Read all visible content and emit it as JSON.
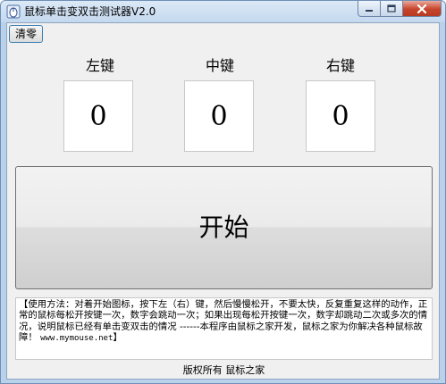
{
  "window": {
    "title": "鼠标单击变双击测试器V2.0"
  },
  "toolbar": {
    "reset_label": "清零"
  },
  "keys": [
    {
      "label": "左键",
      "count": "0"
    },
    {
      "label": "中键",
      "count": "0"
    },
    {
      "label": "右键",
      "count": "0"
    }
  ],
  "start": {
    "label": "开始"
  },
  "instructions": {
    "text": "【使用方法：对着开始图标，按下左（右）键，然后慢慢松开，不要太快，反复重复这样的动作，正常的鼠标每松开按键一次，数字会跳动一次；如果出现每松开按键一次，数字却跳动二次或多次的情况，说明鼠标已经有单击变双击的情况 ------本程序由鼠标之家开发，鼠标之家为你解决各种鼠标故障！ ",
    "url": "www.mymouse.net",
    "suffix": "】"
  },
  "footer": {
    "text": "版权所有 鼠标之家"
  },
  "colors": {
    "frame": "#b9d1ea",
    "client": "#f0f0f0",
    "close_button": "#c7442c"
  },
  "icons": {
    "app": "mouse-app-icon",
    "minimize": "minimize-icon",
    "maximize": "maximize-icon",
    "close": "close-icon"
  }
}
